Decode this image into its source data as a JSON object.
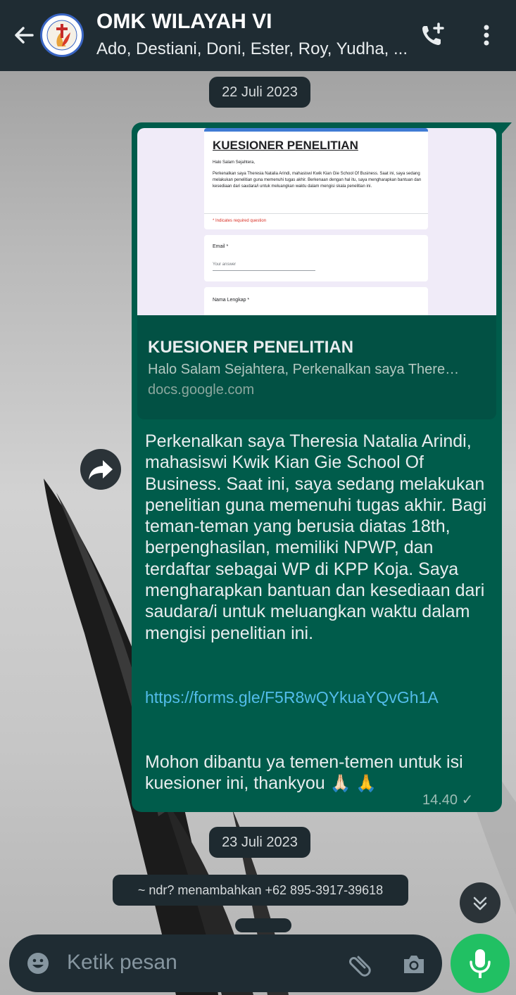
{
  "header": {
    "title": "OMK WILAYAH VI",
    "subtitle": "Ado, Destiani, Doni, Ester, Roy, Yudha, ...",
    "avatar_ring_text": "OMK WILAYAH VI",
    "icons": [
      "back-arrow-icon",
      "add-call-icon",
      "more-vert-icon"
    ]
  },
  "chat": {
    "date1": "22 Juli 2023",
    "message": {
      "link_preview": {
        "form_title": "KUESIONER PENELITIAN",
        "form_greeting": "Halo Salam Sejahtera,",
        "form_intro": "Perkenalkan saya Theresia Natalia Arindi, mahasiswi Kwik Kian Gie School Of Business. Saat ini, saya sedang melakukan penelitian guna memenuhi tugas akhir. Berkenaan dengan hal itu, saya mengharapkan bantuan dan kesediaan dari saudara/i untuk meluangkan waktu dalam mengisi skala penelitian ini.",
        "required_note": "* Indicates required question",
        "email_label": "Email *",
        "email_placeholder": "Your answer",
        "name_label": "Nama Lengkap *",
        "title": "KUESIONER PENELITIAN",
        "description": "Halo Salam Sejahtera, Perkenalkan saya There…",
        "domain": "docs.google.com"
      },
      "body": "Perkenalkan saya Theresia Natalia Arindi, mahasiswi Kwik Kian Gie School Of Business. Saat ini, saya sedang melakukan penelitian guna memenuhi tugas akhir. Bagi teman-teman yang berusia diatas 18th, berpenghasilan, memiliki NPWP, dan terdaftar sebagai WP di KPP Koja. Saya mengharapkan bantuan dan kesediaan dari saudara/i untuk meluangkan waktu dalam mengisi penelitian ini.",
      "link": "https://forms.gle/F5R8wQYkuaYQvGh1A",
      "closing": "Mohon dibantu ya temen-temen untuk isi kuesioner ini, thankyou",
      "emojis": "🙏🏻 🙏",
      "time": "14.40 ✓"
    },
    "date2": "23 Juli 2023",
    "system_message": "~ ndr? menambahkan +62 895-3917-39618"
  },
  "input": {
    "placeholder": "Ketik pesan"
  },
  "colors": {
    "header_bg": "#1f2c33",
    "bubble_out": "#005c4b",
    "link_color": "#53bdeb",
    "mic_button": "#21c063"
  }
}
